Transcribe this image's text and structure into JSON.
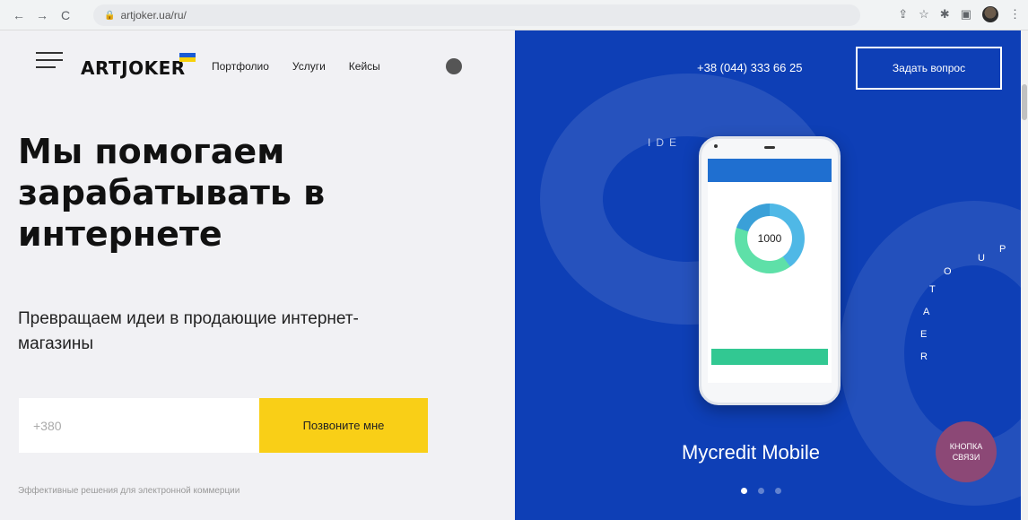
{
  "browser": {
    "url": "artjoker.ua/ru/",
    "back_icon": "←",
    "forward_icon": "→",
    "reload_icon": "C"
  },
  "header": {
    "logo_text": "ARTJOKER",
    "nav": [
      "Портфолио",
      "Услуги",
      "Кейсы"
    ],
    "phone": "+38 (044) 333 66 25",
    "ask_button": "Задать вопрос"
  },
  "hero": {
    "title": "Мы помогаем зарабатывать в интернете",
    "subtitle": "Превращаем идеи в продающие интернет-магазины",
    "phone_placeholder": "+380",
    "call_button": "Позвоните мне",
    "footnote": "Эффективные решения для электронной коммерции"
  },
  "slider": {
    "idea_text": "IDE",
    "phone_value": "1000",
    "slide_title": "Mycredit Mobile",
    "dots_count": 3,
    "active_dot": 0
  },
  "contact_button": "КНОПКА СВЯЗИ",
  "colors": {
    "brand_blue": "#0e3fb6",
    "accent_yellow": "#f9cf17",
    "contact_purple": "#8c4876"
  }
}
